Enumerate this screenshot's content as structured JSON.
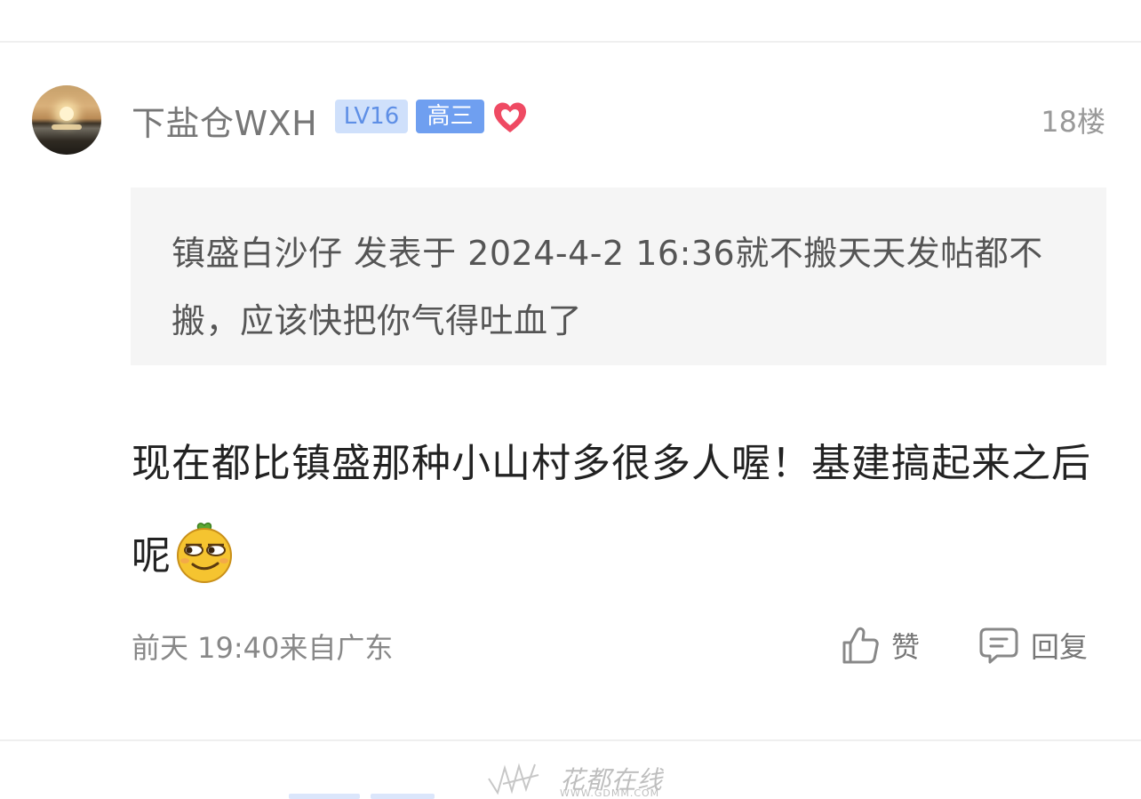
{
  "post": {
    "username": "下盐仓WXH",
    "level_badge": "LV16",
    "grade_badge": "高三",
    "floor": "18楼",
    "quote": {
      "text": "镇盛白沙仔 发表于 2024-4-2 16:36就不搬天天发帖都不搬，应该快把你气得吐血了"
    },
    "content": "现在都比镇盛那种小山村多很多人喔！基建搞起来之后呢",
    "meta": "前天 19:40来自广东",
    "actions": {
      "like_label": "赞",
      "reply_label": "回复"
    }
  },
  "watermark": {
    "text": "花都在线",
    "url": "WWW.GDMM.COM"
  },
  "colors": {
    "level_badge_bg": "#cfe0fb",
    "grade_badge_bg": "#6f9ff0",
    "heart": "#ef4a63",
    "quote_bg": "#f5f5f5"
  },
  "icons": [
    "heart-icon",
    "laugh-emoji-icon",
    "thumb-up-icon",
    "comment-icon"
  ]
}
